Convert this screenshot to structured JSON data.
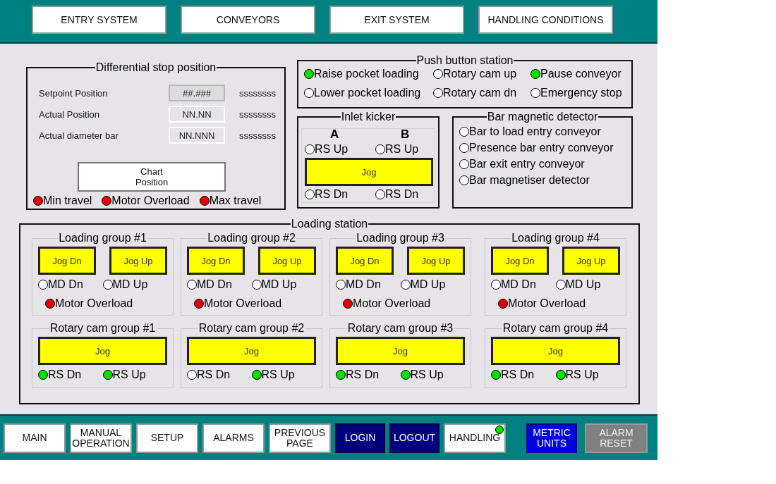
{
  "top_nav": [
    "ENTRY SYSTEM",
    "CONVEYORS",
    "EXIT SYSTEM",
    "HANDLING CONDITIONS"
  ],
  "differential": {
    "title": "Differential stop position",
    "fields": [
      {
        "label": "Setpoint Position",
        "value": "##.###",
        "unit": "ssssssss",
        "kind": "setpoint"
      },
      {
        "label": "Actual Position",
        "value": "NN.NN",
        "unit": "ssssssss",
        "kind": "readout"
      },
      {
        "label": "Actual diameter bar",
        "value": "NN.NNN",
        "unit": "ssssssss",
        "kind": "readout"
      }
    ],
    "chart_button": "Chart\nPosition",
    "indicators": [
      {
        "label": "Min travel",
        "on": true,
        "color": "#e00000"
      },
      {
        "label": "Motor Overload",
        "on": true,
        "color": "#e00000"
      },
      {
        "label": "Max travel",
        "on": true,
        "color": "#e00000"
      }
    ]
  },
  "push_station": {
    "title": "Push button station",
    "indicators": [
      {
        "label": "Raise pocket loading",
        "on": true,
        "color": "#00e000"
      },
      {
        "label": "Rotary cam up",
        "on": false
      },
      {
        "label": "Pause conveyor",
        "on": true,
        "color": "#00e000"
      },
      {
        "label": "Lower pocket loading",
        "on": false
      },
      {
        "label": "Rotary cam dn",
        "on": false
      },
      {
        "label": "Emergency stop",
        "on": false
      }
    ]
  },
  "inlet_kicker": {
    "title": "Inlet kicker",
    "headers": [
      "A",
      "B"
    ],
    "top_indicators": [
      {
        "label": "RS Up",
        "on": false
      },
      {
        "label": "RS Up",
        "on": false
      }
    ],
    "jog": "Jog",
    "bottom_indicators": [
      {
        "label": "RS Dn",
        "on": false
      },
      {
        "label": "RS Dn",
        "on": false
      }
    ]
  },
  "bar_detector": {
    "title": "Bar magnetic detector",
    "indicators": [
      {
        "label": "Bar to load entry conveyor",
        "on": false
      },
      {
        "label": "Presence bar entry conveyor",
        "on": false
      },
      {
        "label": "Bar exit entry conveyor",
        "on": false
      },
      {
        "label": "Bar magnetiser detector",
        "on": false
      }
    ]
  },
  "loading_station": {
    "title": "Loading station",
    "loading_groups": [
      {
        "title": "Loading group #1",
        "buttons": [
          "Jog Dn",
          "Jog Up"
        ],
        "indicators": [
          {
            "label": "MD Dn",
            "on": false
          },
          {
            "label": "MD Up",
            "on": false
          }
        ],
        "overload": {
          "label": "Motor Overload",
          "on": true,
          "color": "#e00000"
        }
      },
      {
        "title": "Loading group #2",
        "buttons": [
          "Jog Dn",
          "Jog Up"
        ],
        "indicators": [
          {
            "label": "MD Dn",
            "on": false
          },
          {
            "label": "MD Up",
            "on": false
          }
        ],
        "overload": {
          "label": "Motor Overload",
          "on": true,
          "color": "#e00000"
        }
      },
      {
        "title": "Loading group #3",
        "buttons": [
          "Jog Dn",
          "Jog Up"
        ],
        "indicators": [
          {
            "label": "MD Dn",
            "on": false
          },
          {
            "label": "MD Up",
            "on": false
          }
        ],
        "overload": {
          "label": "Motor Overload",
          "on": true,
          "color": "#e00000"
        }
      },
      {
        "title": "Loading group #4",
        "buttons": [
          "Jog Dn",
          "Jog Up"
        ],
        "indicators": [
          {
            "label": "MD Dn",
            "on": false
          },
          {
            "label": "MD Up",
            "on": false
          }
        ],
        "overload": {
          "label": "Motor Overload",
          "on": true,
          "color": "#e00000"
        }
      }
    ],
    "rotary_groups": [
      {
        "title": "Rotary cam group #1",
        "jog": "Jog",
        "indicators": [
          {
            "label": "RS Dn",
            "on": true,
            "color": "#00e000"
          },
          {
            "label": "RS Up",
            "on": true,
            "color": "#00e000"
          }
        ]
      },
      {
        "title": "Rotary cam group #2",
        "jog": "Jog",
        "indicators": [
          {
            "label": "RS Dn",
            "on": false
          },
          {
            "label": "RS Up",
            "on": true,
            "color": "#00e000"
          }
        ]
      },
      {
        "title": "Rotary cam group #3",
        "jog": "Jog",
        "indicators": [
          {
            "label": "RS Dn",
            "on": true,
            "color": "#00e000"
          },
          {
            "label": "RS Up",
            "on": true,
            "color": "#00e000"
          }
        ]
      },
      {
        "title": "Rotary cam group #4",
        "jog": "Jog",
        "indicators": [
          {
            "label": "RS Dn",
            "on": true,
            "color": "#00e000"
          },
          {
            "label": "RS Up",
            "on": true,
            "color": "#00e000"
          }
        ]
      }
    ]
  },
  "bottom_nav": [
    {
      "label": "MAIN",
      "kind": "light"
    },
    {
      "label": "MANUAL\nOPERATION",
      "kind": "light"
    },
    {
      "label": "SETUP",
      "kind": "light"
    },
    {
      "label": "ALARMS",
      "kind": "light"
    },
    {
      "label": "PREVIOUS\nPAGE",
      "kind": "light"
    },
    {
      "label": "LOGIN",
      "kind": "dark"
    },
    {
      "label": "LOGOUT",
      "kind": "dark"
    },
    {
      "label": "HANDLING",
      "kind": "light",
      "on": true,
      "color": "#00e000"
    },
    {
      "label": "METRIC\nUNITS",
      "kind": "blue"
    },
    {
      "label": "ALARM\nRESET",
      "kind": "grey"
    }
  ]
}
